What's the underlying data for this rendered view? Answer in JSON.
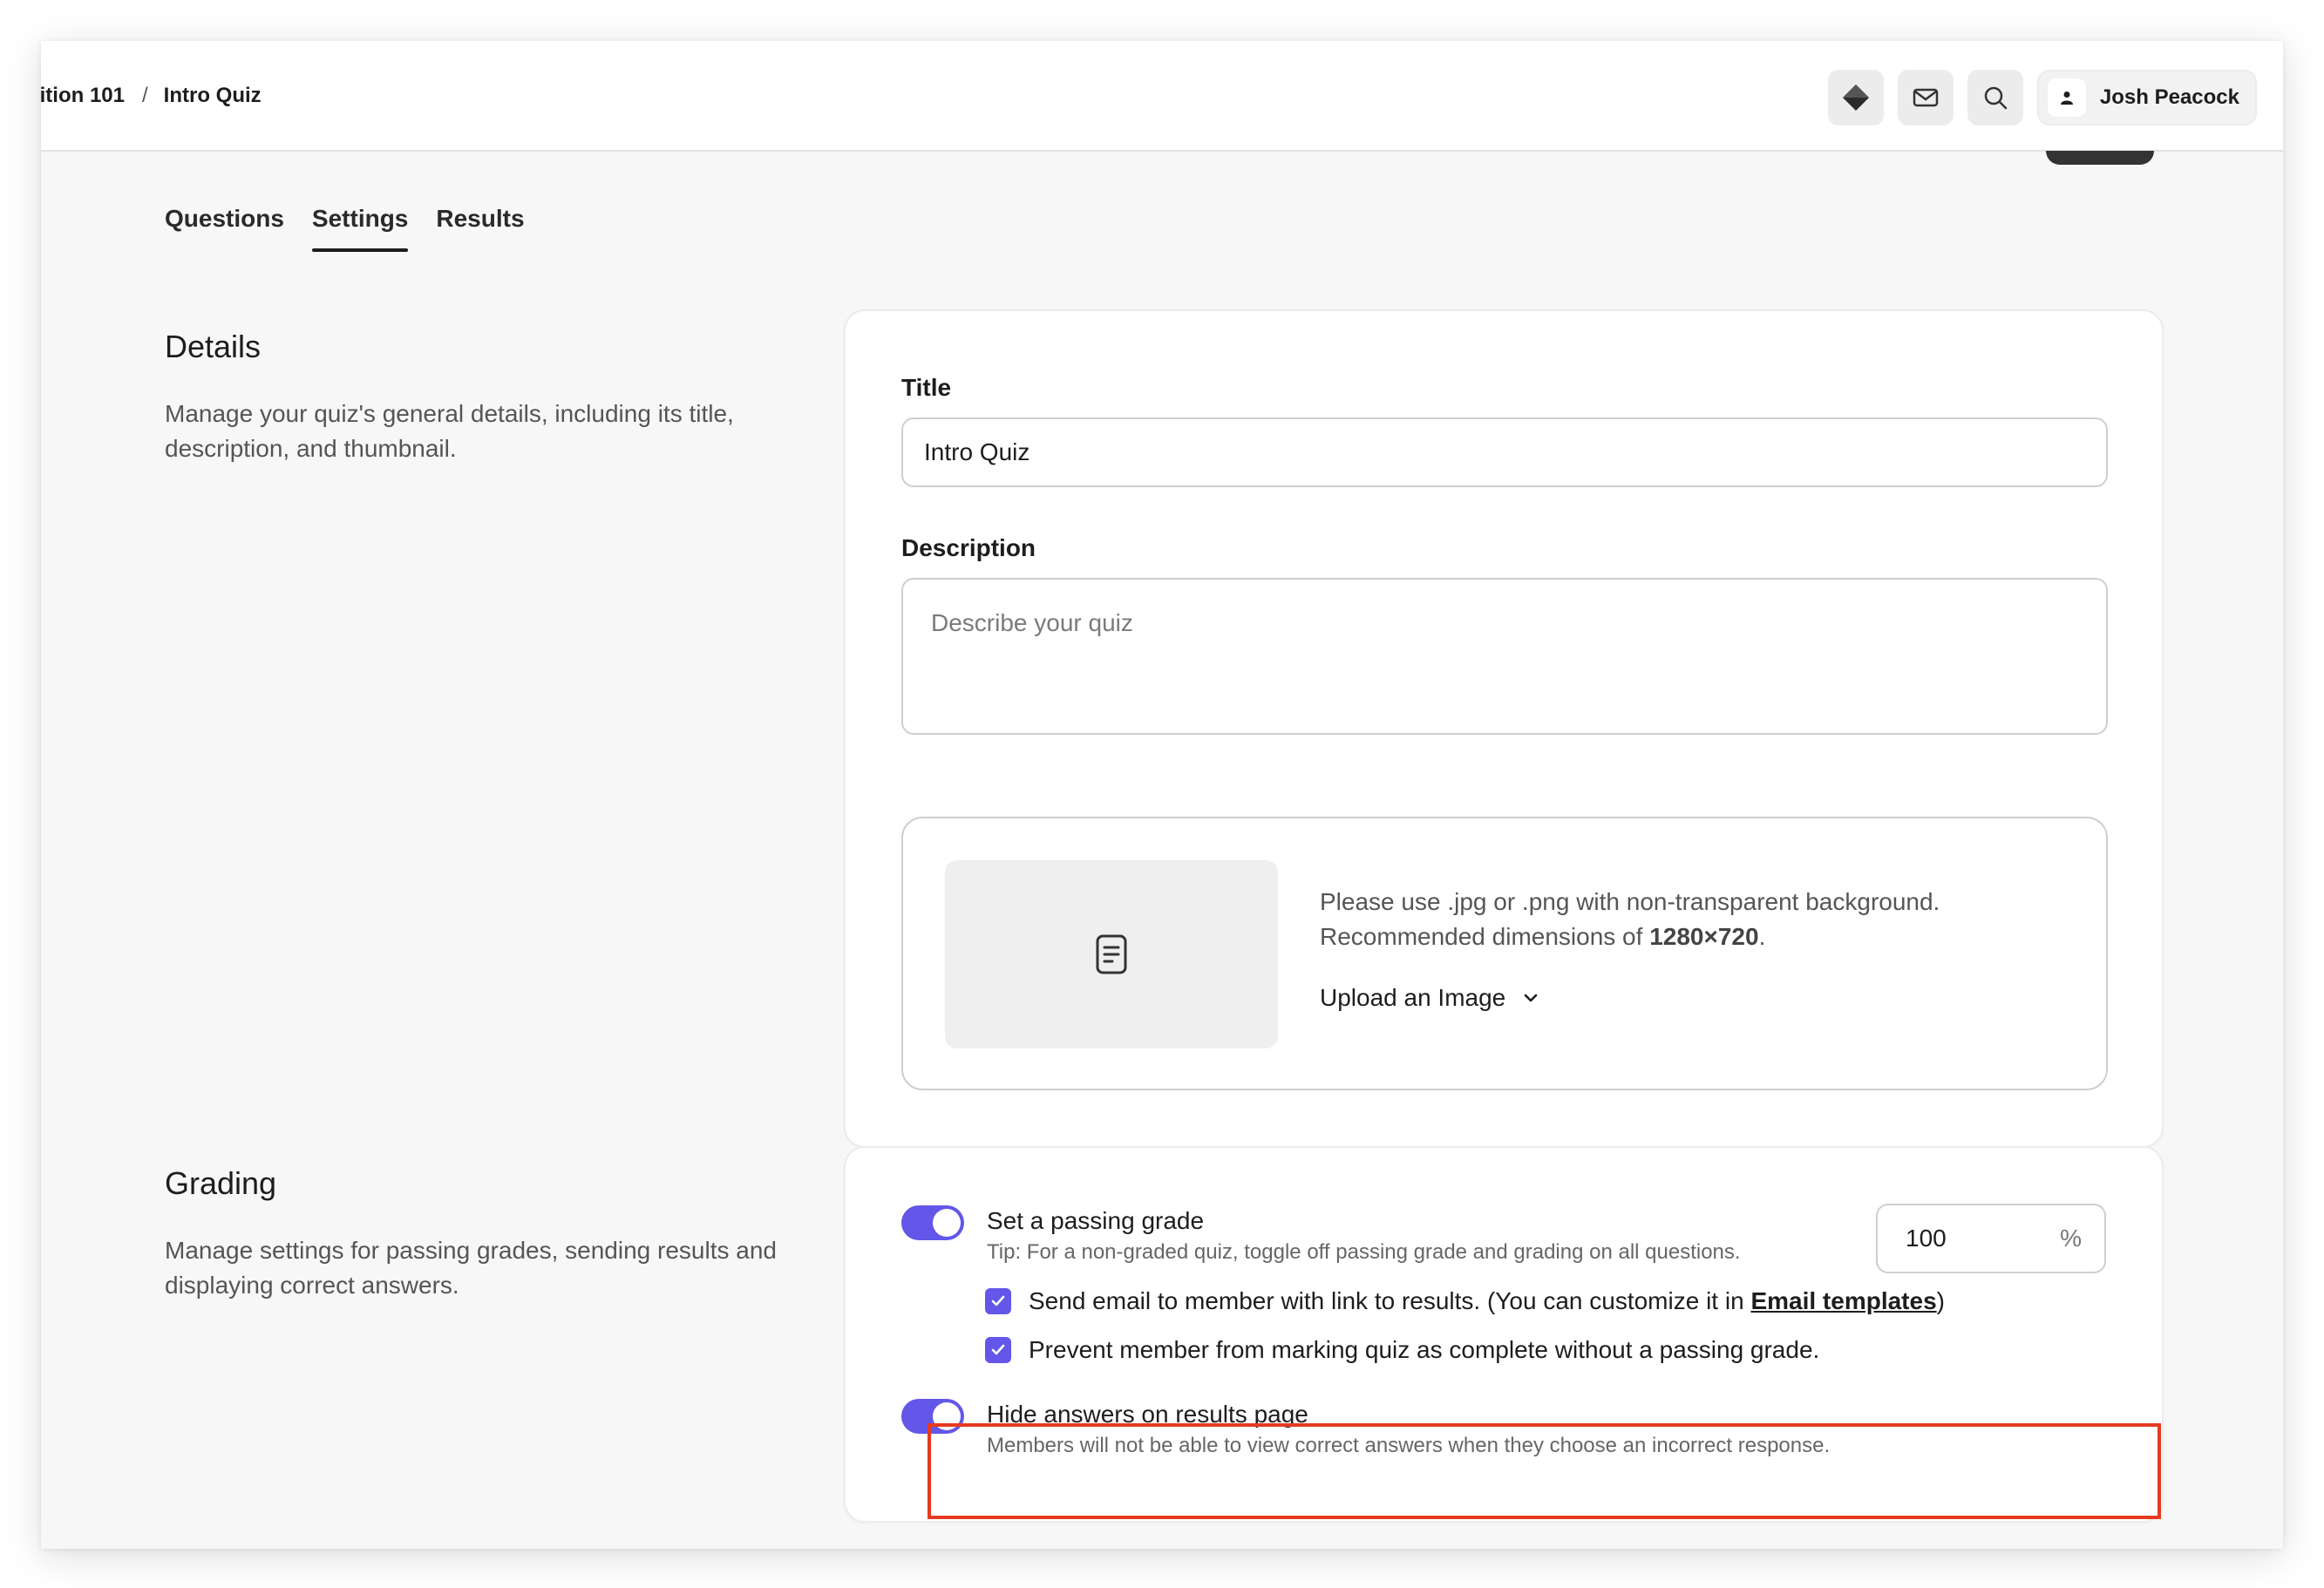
{
  "topbar": {
    "breadcrumb_parent": "ition 101",
    "breadcrumb_separator": "/",
    "breadcrumb_current": "Intro Quiz",
    "icons": [
      "diamond-icon",
      "mail-icon",
      "search-icon"
    ],
    "user_name": "Josh Peacock"
  },
  "tabs": [
    {
      "label": "Questions",
      "active": false
    },
    {
      "label": "Settings",
      "active": true
    },
    {
      "label": "Results",
      "active": false
    }
  ],
  "details": {
    "title": "Details",
    "description": "Manage your quiz's general details, including its title, description, and thumbnail.",
    "title_label": "Title",
    "title_value": "Intro Quiz",
    "description_label": "Description",
    "description_placeholder": "Describe your quiz",
    "thumbnail_info_1": "Please use .jpg or .png with non-transparent background.",
    "thumbnail_info_2_prefix": "Recommended dimensions of ",
    "thumbnail_info_2_value": "1280×720",
    "thumbnail_info_2_suffix": ".",
    "upload_label": "Upload an Image"
  },
  "grading": {
    "title": "Grading",
    "description": "Manage settings for passing grades, sending results and displaying correct answers.",
    "passing_grade": {
      "label": "Set a passing grade",
      "tip": "Tip: For a non-graded quiz, toggle off passing grade and grading on all questions.",
      "enabled": true,
      "value": "100",
      "unit": "%"
    },
    "send_email": {
      "prefix": "Send email to member with link to results. (You can customize it in ",
      "link": "Email templates",
      "suffix": ")",
      "checked": true
    },
    "prevent_complete": {
      "label": "Prevent member from marking quiz as complete without a passing grade.",
      "checked": true
    },
    "hide_answers": {
      "label": "Hide answers on results page",
      "description": "Members will not be able to view correct answers when they choose an incorrect response.",
      "enabled": true
    }
  },
  "colors": {
    "accent": "#6257e8",
    "highlight": "#e53a20"
  }
}
